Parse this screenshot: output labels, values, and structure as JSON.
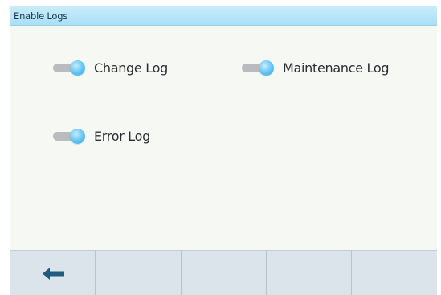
{
  "header": {
    "title": "Enable Logs"
  },
  "toggles": [
    {
      "label": "Change Log",
      "state": "on"
    },
    {
      "label": "Maintenance Log",
      "state": "on"
    },
    {
      "label": "Error Log",
      "state": "on"
    }
  ],
  "softkeys": [
    {
      "icon": "arrow-left-icon"
    },
    {
      "icon": ""
    },
    {
      "icon": ""
    },
    {
      "icon": ""
    },
    {
      "icon": ""
    }
  ],
  "colors": {
    "title_bar": "#b5e3f9",
    "toggle_knob": "#4db8ee",
    "toggle_track": "#b9bcbe",
    "back_arrow": "#1f5b7f"
  }
}
